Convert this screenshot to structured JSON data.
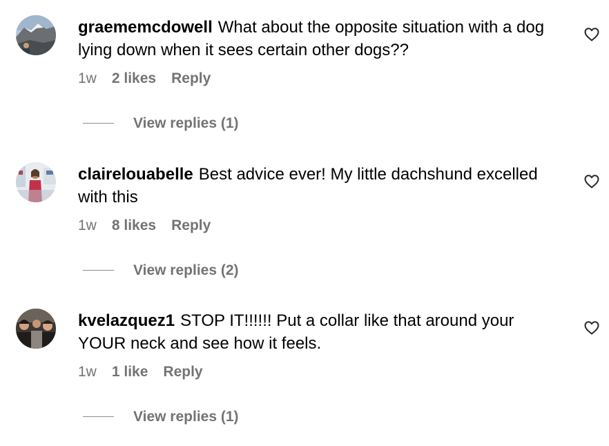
{
  "comments": [
    {
      "username": "graememcdowell",
      "text": "What about the opposite situation with a dog lying down when it sees certain other dogs??",
      "time": "1w",
      "likes": "2 likes",
      "reply": "Reply",
      "view_replies": "View replies (1)",
      "avatar_icon": "mountain-avatar",
      "liked": false
    },
    {
      "username": "clairelouabelle",
      "text": "Best advice ever! My little dachshund excelled with this",
      "time": "1w",
      "likes": "8 likes",
      "reply": "Reply",
      "view_replies": "View replies (2)",
      "avatar_icon": "person-avatar",
      "liked": false
    },
    {
      "username": "kvelazquez1",
      "text": "STOP IT!!!!!! Put a collar like that around your YOUR neck and see how it feels.",
      "time": "1w",
      "likes": "1 like",
      "reply": "Reply",
      "view_replies": "View replies (1)",
      "avatar_icon": "group-avatar",
      "liked": false
    }
  ],
  "colors": {
    "text": "#000000",
    "secondary": "#737373",
    "divider": "#8e8e8e"
  }
}
